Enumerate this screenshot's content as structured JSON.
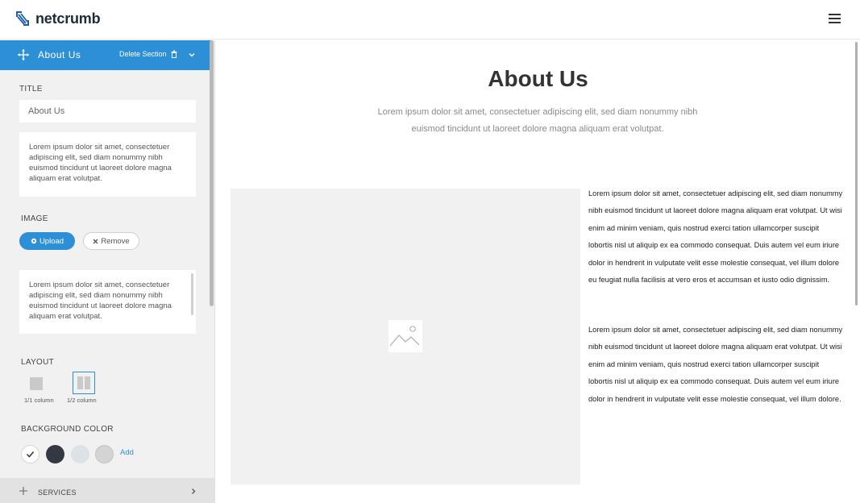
{
  "brand": {
    "name": "netcrumb"
  },
  "sidebar": {
    "section_title": "About Us",
    "delete_section": "Delete Section",
    "title_label": "TITLE",
    "title_value": "About Us",
    "title_text": "Lorem ipsum dolor sit amet, consectetuer adipiscing elit, sed diam nonummy nibh euismod tincidunt ut laoreet dolore magna aliquam erat volutpat.",
    "image_label": "IMAGE",
    "upload": "Upload",
    "remove": "Remove",
    "image_text": "Lorem ipsum dolor sit amet, consectetuer adipiscing elit, sed diam nonummy nibh euismod tincidunt ut laoreet dolore magna aliquam erat volutpat.",
    "layout_label": "LAYOUT",
    "layouts": [
      {
        "label": "1/1 column",
        "selected": false
      },
      {
        "label": "1/2 column",
        "selected": true
      }
    ],
    "bg_label": "BACKGROUND COLOR",
    "swatches": [
      "#ffffff",
      "#333842",
      "#dde2e6",
      "#d4d4d4"
    ],
    "add": "Add",
    "next_section": "SERVICES"
  },
  "main": {
    "title": "About Us",
    "subtitle": "Lorem ipsum dolor sit amet, consectetuer adipiscing elit, sed diam nonummy nibh euismod tincidunt ut laoreet dolore magna aliquam erat volutpat.",
    "paragraph1": "Lorem ipsum dolor sit amet, consectetuer adipiscing elit, sed diam nonummy nibh euismod tincidunt ut laoreet dolore magna aliquam erat volutpat. Ut wisi enim ad minim veniam, quis nostrud exerci tation ullamcorper suscipit lobortis nisl ut aliquip ex ea commodo consequat. Duis autem vel eum iriure dolor in hendrerit in vulputate velit esse molestie consequat, vel illum dolore eu feugiat nulla facilisis at vero eros et accumsan et iusto odio dignissim.",
    "paragraph2": "Lorem ipsum dolor sit amet, consectetuer adipiscing elit, sed diam nonummy nibh euismod tincidunt ut laoreet dolore magna aliquam erat volutpat. Ut wisi enim ad minim veniam, quis nostrud exerci tation ullamcorper suscipit lobortis nisl ut aliquip ex ea commodo consequat. Duis autem vel eum iriure dolor in hendrerit in vulputate velit esse molestie consequat, vel illum dolore."
  },
  "colors": {
    "accent": "#2d8fd5",
    "sidebar_bg": "#f1f1f1",
    "placeholder_bg": "#f1f1f1"
  },
  "icons": [
    "netcrumb-logo-icon",
    "hamburger-menu-icon",
    "move-icon",
    "trash-icon",
    "chevron-down-icon",
    "gear-icon",
    "close-icon",
    "image-placeholder-icon",
    "checkmark-icon",
    "chevron-right-icon"
  ]
}
